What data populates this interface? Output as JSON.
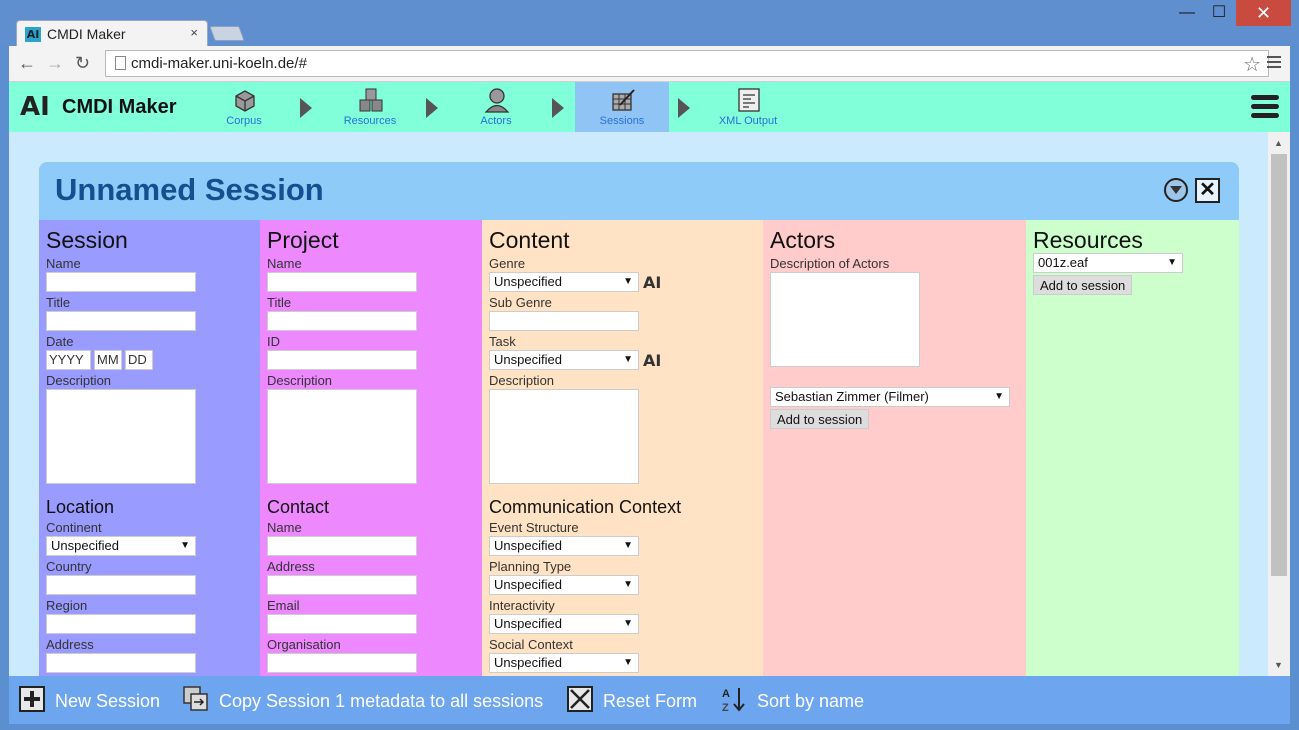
{
  "browser": {
    "tab_title": "CMDI Maker",
    "tab_close": "×",
    "url": "cmdi-maker.uni-koeln.de/#",
    "window_min": "—",
    "window_max": "☐",
    "window_close": "✕"
  },
  "app": {
    "logo": "AI",
    "name": "CMDI Maker",
    "nav": [
      {
        "label": "Corpus",
        "icon": "cube-icon",
        "active": false
      },
      {
        "label": "Resources",
        "icon": "cubes-icon",
        "active": false
      },
      {
        "label": "Actors",
        "icon": "person-icon",
        "active": false
      },
      {
        "label": "Sessions",
        "icon": "session-icon",
        "active": true
      },
      {
        "label": "XML Output",
        "icon": "document-icon",
        "active": false
      }
    ]
  },
  "session": {
    "title": "Unnamed Session",
    "session_col": {
      "heading": "Session",
      "name_label": "Name",
      "title_label": "Title",
      "date_label": "Date",
      "date_year_placeholder": "YYYY",
      "date_month_placeholder": "MM",
      "date_day_placeholder": "DD",
      "description_label": "Description",
      "location_heading": "Location",
      "continent_label": "Continent",
      "continent_value": "Unspecified",
      "country_label": "Country",
      "region_label": "Region",
      "address_label": "Address"
    },
    "project_col": {
      "heading": "Project",
      "name_label": "Name",
      "title_label": "Title",
      "id_label": "ID",
      "description_label": "Description",
      "contact_heading": "Contact",
      "contact_name_label": "Name",
      "contact_address_label": "Address",
      "contact_email_label": "Email",
      "contact_organisation_label": "Organisation"
    },
    "content_col": {
      "heading": "Content",
      "genre_label": "Genre",
      "genre_value": "Unspecified",
      "subgenre_label": "Sub Genre",
      "task_label": "Task",
      "task_value": "Unspecified",
      "description_label": "Description",
      "comm_heading": "Communication Context",
      "event_structure_label": "Event Structure",
      "event_structure_value": "Unspecified",
      "planning_type_label": "Planning Type",
      "planning_type_value": "Unspecified",
      "interactivity_label": "Interactivity",
      "interactivity_value": "Unspecified",
      "social_context_label": "Social Context",
      "social_context_value": "Unspecified"
    },
    "actors_col": {
      "heading": "Actors",
      "description_label": "Description of Actors",
      "actor_select_value": "Sebastian Zimmer (Filmer)",
      "add_button": "Add to session"
    },
    "resources_col": {
      "heading": "Resources",
      "resource_select_value": "001z.eaf",
      "add_button": "Add to session"
    }
  },
  "bottom_bar": {
    "new_session": "New Session",
    "copy_metadata": "Copy Session 1 metadata to all sessions",
    "reset_form": "Reset Form",
    "sort_by_name": "Sort by name"
  }
}
